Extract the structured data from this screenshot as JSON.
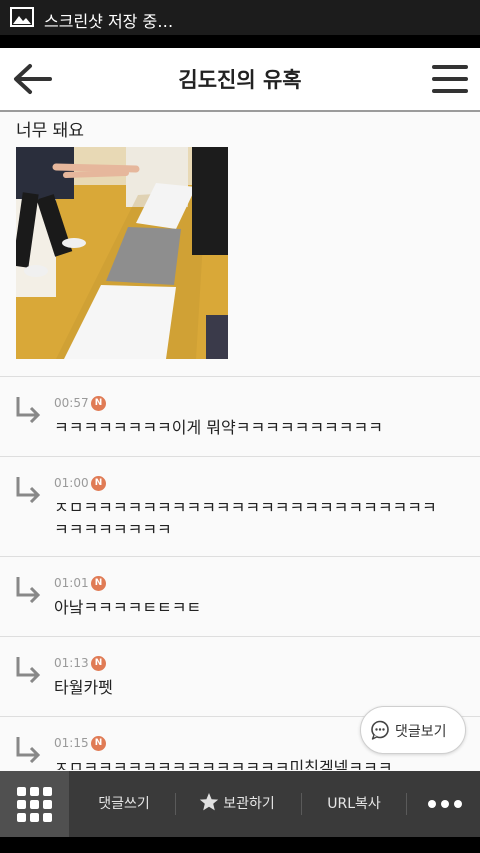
{
  "status_bar": {
    "notification_text": "스크린샷 저장 중…",
    "icon": "image-icon"
  },
  "app_bar": {
    "title": "김도진의 유혹",
    "back_icon": "back-arrow-icon",
    "menu_icon": "hamburger-menu-icon"
  },
  "post": {
    "text": "너무 돼요",
    "image": "photo-towels-on-floor"
  },
  "comments": [
    {
      "time": "00:57",
      "badge": "N",
      "text": "ㅋㅋㅋㅋㅋㅋㅋㅋ이게 뭐약ㅋㅋㅋㅋㅋㅋㅋㅋㅋㅋ"
    },
    {
      "time": "01:00",
      "badge": "N",
      "text": "ㅈㅁㅋㅋㅋㅋㅋㅋㅋㅋㅋㅋㅋㅋㅋㅋㅋㅋㅋㅋㅋㅋㅋㅋㅋㅋㅋㅋㅋㅋㅋㅋㅋㅋ"
    },
    {
      "time": "01:01",
      "badge": "N",
      "text": "아낰ㅋㅋㅋㅋㅌㅌㅋㅌ"
    },
    {
      "time": "01:13",
      "badge": "N",
      "text": "타월카펫"
    },
    {
      "time": "01:15",
      "badge": "N",
      "text": "ㅈㅁㅋㅋㅋㅋㅋㅋㅋㅋㅋㅋㅋㅋㅋㅋ미친겤넼ㅋㅋㅋ"
    }
  ],
  "floating_button": {
    "label": "댓글보기",
    "icon": "speech-bubble-icon"
  },
  "bottom_bar": {
    "grid_icon": "grid-menu-icon",
    "write_comment": "댓글쓰기",
    "bookmark": "보관하기",
    "bookmark_icon": "star-icon",
    "copy_url": "URL복사",
    "more_icon": "more-dots-icon"
  },
  "colors": {
    "badge": "#e07b55",
    "bottom_bar": "#3a3a3a",
    "status_bar": "#1c1c1c"
  }
}
